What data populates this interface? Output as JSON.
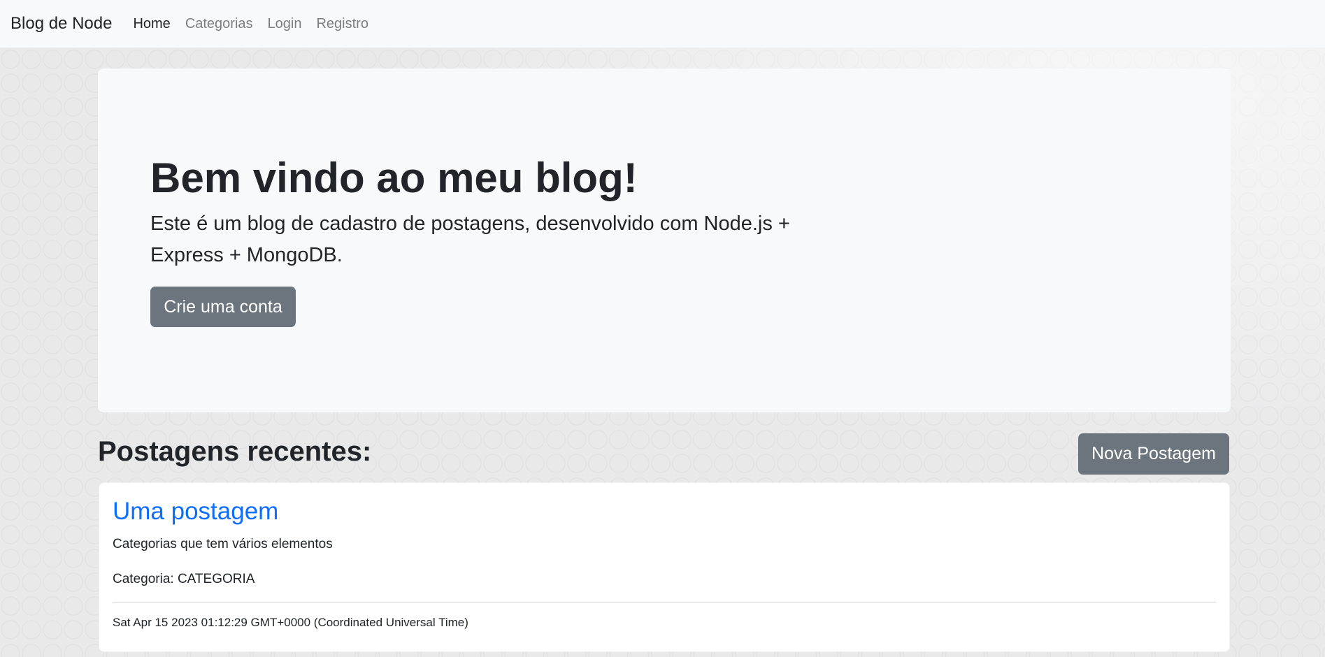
{
  "navbar": {
    "brand": "Blog de Node",
    "links": [
      {
        "label": "Home",
        "active": true
      },
      {
        "label": "Categorias",
        "active": false
      },
      {
        "label": "Login",
        "active": false
      },
      {
        "label": "Registro",
        "active": false
      }
    ]
  },
  "jumbotron": {
    "heading": "Bem vindo ao meu blog!",
    "lead": "Este é um blog de cadastro de postagens, desenvolvido com Node.js + Express + MongoDB.",
    "button_label": "Crie uma conta"
  },
  "recent": {
    "title": "Postagens recentes:",
    "new_post_label": "Nova Postagem",
    "posts": [
      {
        "title": "Uma postagem",
        "description": "Categorias que tem vários elementos",
        "category": "Categoria: CATEGORIA",
        "date": "Sat Apr 15 2023 01:12:29 GMT+0000 (Coordinated Universal Time)"
      }
    ]
  },
  "colors": {
    "navbar_bg": "#f8f9fa",
    "jumbotron_bg": "#f8f9fa",
    "button_secondary": "#6c757d",
    "link_primary": "#0d6efd",
    "text": "#212529",
    "nav_inactive": "#7b7f83"
  }
}
